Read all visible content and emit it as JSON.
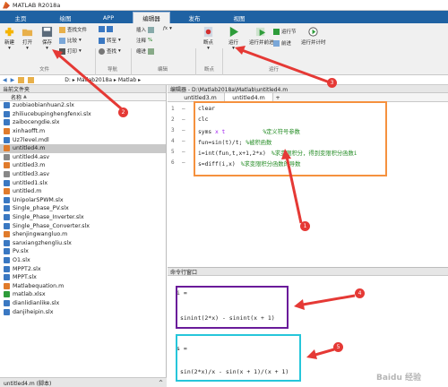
{
  "window": {
    "title": "MATLAB R2018a"
  },
  "tabs": [
    "主页",
    "绘图",
    "APP",
    "编辑器",
    "发布",
    "视图"
  ],
  "ribbon": {
    "file": {
      "new": "新建",
      "open": "打开",
      "save": "保存",
      "find_files": "查找文件",
      "compare": "比较",
      "print": "打印",
      "group": "文件"
    },
    "navigate": {
      "goto": "转至",
      "find": "查找",
      "group": "导航"
    },
    "edit": {
      "insert": "插入",
      "comment": "注释",
      "indent": "缩进",
      "fx": "fx",
      "group": "编辑"
    },
    "breakpoints": {
      "label": "断点",
      "group": "断点"
    },
    "run": {
      "run": "运行",
      "run_advance": "运行并前进",
      "run_section": "运行节",
      "advance": "前进",
      "run_time": "运行并计时",
      "group": "运行"
    }
  },
  "address": {
    "path": "D: ▸ Matlab2018a ▸ Matlab ▸"
  },
  "left_panel": {
    "title": "当前文件夹",
    "col_name": "名称",
    "sort": "▲",
    "files": [
      {
        "name": "zuobiaobianhuan2.slx",
        "type": "slx"
      },
      {
        "name": "zhiliucebupinghengfenxi.slx",
        "type": "slx"
      },
      {
        "name": "zaibocengdie.slx",
        "type": "slx"
      },
      {
        "name": "xinhaofft.m",
        "type": "m"
      },
      {
        "name": "Uz7level.mdl",
        "type": "mdl"
      },
      {
        "name": "untitled4.m",
        "type": "m",
        "selected": true
      },
      {
        "name": "untitled4.asv",
        "type": "asv"
      },
      {
        "name": "untitled3.m",
        "type": "m"
      },
      {
        "name": "untitled3.asv",
        "type": "asv"
      },
      {
        "name": "untitled1.slx",
        "type": "slx"
      },
      {
        "name": "untitled.m",
        "type": "m"
      },
      {
        "name": "UnipolarSPWM.slx",
        "type": "slx"
      },
      {
        "name": "Single_phase_PV.slx",
        "type": "slx"
      },
      {
        "name": "Single_Phase_Inverter.slx",
        "type": "slx"
      },
      {
        "name": "Single_Phase_Converter.slx",
        "type": "slx"
      },
      {
        "name": "shenjingwangluo.m",
        "type": "m"
      },
      {
        "name": "sanxiangzhengliu.slx",
        "type": "slx"
      },
      {
        "name": "Pv.slx",
        "type": "slx"
      },
      {
        "name": "O1.slx",
        "type": "slx"
      },
      {
        "name": "MPPT2.slx",
        "type": "slx"
      },
      {
        "name": "MPPT.slx",
        "type": "slx"
      },
      {
        "name": "Matlabequation.m",
        "type": "m"
      },
      {
        "name": "matlab.xlsx",
        "type": "xlsx"
      },
      {
        "name": "dianlidianlike.slx",
        "type": "slx"
      },
      {
        "name": "danjiheipin.slx",
        "type": "slx"
      }
    ],
    "details": "untitled4.m (脚本)",
    "details_toggle": "^"
  },
  "editor": {
    "title": "编辑器 - D:\\Matlab2018a\\Matlab\\untitled4.m",
    "tabs": [
      "untitled3.m",
      "untitled4.m",
      "+"
    ],
    "lines": [
      {
        "n": "1",
        "code": "clear",
        "comment": ""
      },
      {
        "n": "2",
        "code": "clc",
        "comment": ""
      },
      {
        "n": "3",
        "code": "syms x t",
        "comment": "%定义符号参数"
      },
      {
        "n": "4",
        "code": "fun=sin(t)/t;",
        "comment": "%被积函数"
      },
      {
        "n": "5",
        "code": "i=int(fun,t,x+1,2*x)",
        "comment": "%求变限积分，得到变限积分函数i"
      },
      {
        "n": "6",
        "code": "s=diff(i,x)",
        "comment": "%求变限积分函数的导数"
      }
    ]
  },
  "command": {
    "title": "命令行窗口",
    "out1_label": "i =",
    "out1_value": "sinint(2*x) - sinint(x + 1)",
    "out2_label": "s =",
    "out2_value": "sin(2*x)/x - sin(x + 1)/(x + 1)"
  },
  "badges": [
    "1",
    "2",
    "3",
    "4",
    "5"
  ],
  "watermark": "Baidu 经验",
  "colors": {
    "tabbar": "#1f62a3",
    "orange_box": "#f5913e",
    "purple_box": "#6a1b9a",
    "cyan_box": "#26c6da",
    "badge": "#e53935",
    "arrow": "#e53935"
  }
}
